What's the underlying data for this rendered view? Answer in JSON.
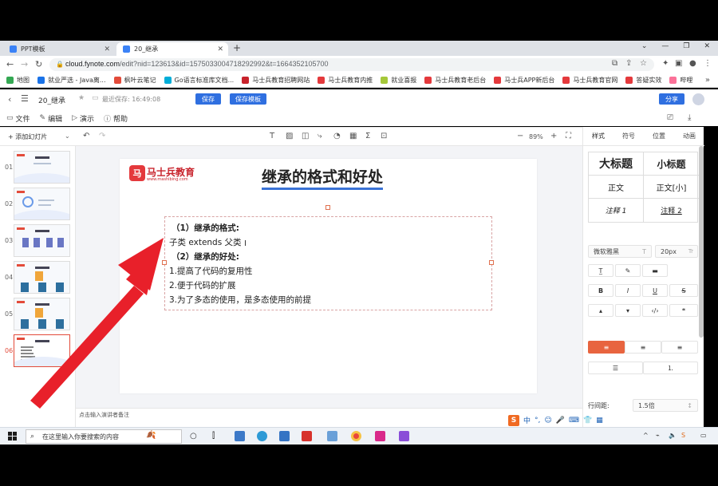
{
  "browser": {
    "tabs": [
      {
        "label": "PPT模板",
        "active": false
      },
      {
        "label": "20_继承",
        "active": true
      }
    ],
    "url_host": "cloud.fynote.com",
    "url_rest": "/edit?nid=123613&id=1575033004718292992&t=1664352105700",
    "bookmarks": [
      {
        "label": "地图",
        "color": "#34a853"
      },
      {
        "label": "就业严选 - Java离...",
        "color": "#1a73e8"
      },
      {
        "label": "枫叶云笔记",
        "color": "#e34b3a"
      },
      {
        "label": "Go语言标准库文档...",
        "color": "#00add8"
      },
      {
        "label": "马士兵教育招聘网站",
        "color": "#c8232c"
      },
      {
        "label": "马士兵教育内推",
        "color": "#e4393c"
      },
      {
        "label": "就业喜报",
        "color": "#a5c83a"
      },
      {
        "label": "马士兵教育老后台",
        "color": "#e4393c"
      },
      {
        "label": "马士兵APP新后台",
        "color": "#e4393c"
      },
      {
        "label": "马士兵教育官网",
        "color": "#e4393c"
      },
      {
        "label": "答疑实效",
        "color": "#e4393c"
      },
      {
        "label": "哔哩",
        "color": "#fb7299"
      }
    ]
  },
  "app": {
    "doc_title": "20_继承",
    "saved_text": "最近保存: 16:49:08",
    "save_label": "保存",
    "save_template_label": "保存模板",
    "share_label": "分享",
    "menu": {
      "file": "文件",
      "edit": "编辑",
      "present": "演示",
      "help": "帮助"
    },
    "toolbar": {
      "add_slide": "+ 添加幻灯片",
      "zoom": "89%"
    },
    "slides": [
      "01",
      "02",
      "03",
      "04",
      "05",
      "06"
    ],
    "notes_placeholder": "点击输入演讲者备注"
  },
  "slide": {
    "logo_name": "马士兵教育",
    "logo_sub": "www.mashibing.com",
    "title": "继承的格式和好处",
    "lines": [
      "（1）继承的格式:",
      "子类 extends 父类",
      "（2）继承的好处:",
      "1.提高了代码的复用性",
      "2.便于代码的扩展",
      "3.为了多态的使用，是多态使用的前提"
    ]
  },
  "right_panel": {
    "tabs": [
      "样式",
      "符号",
      "位置",
      "动画"
    ],
    "styles": [
      "大标题",
      "小标题",
      "正文",
      "正文[小]",
      "注释 1",
      "注释 2"
    ],
    "font": "微软雅黑",
    "font_size": "20px",
    "line_spacing_label": "行间距:",
    "line_spacing_value": "1.5倍"
  },
  "taskbar": {
    "search_placeholder": "在这里输入你要搜索的内容",
    "ime_label": "中"
  }
}
